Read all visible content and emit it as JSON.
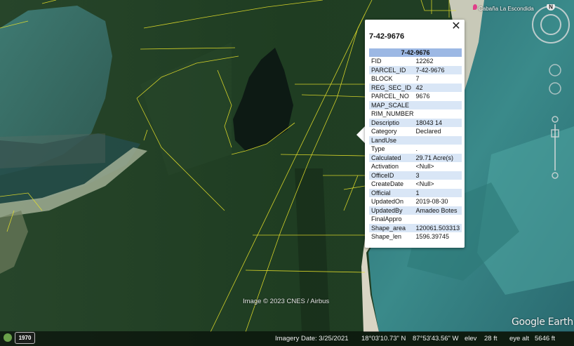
{
  "popup": {
    "title": "7-42-9676",
    "table_header": "7-42-9676",
    "close_label": "✕",
    "rows": [
      {
        "key": "FID",
        "value": "12262"
      },
      {
        "key": "PARCEL_ID",
        "value": "7-42-9676"
      },
      {
        "key": "BLOCK",
        "value": "7"
      },
      {
        "key": "REG_SEC_ID",
        "value": "42"
      },
      {
        "key": "PARCEL_NO",
        "value": "9676"
      },
      {
        "key": "MAP_SCALE",
        "value": ""
      },
      {
        "key": "RIM_NUMBER",
        "value": ""
      },
      {
        "key": "Descriptio",
        "value": "18043 14"
      },
      {
        "key": "Category",
        "value": "Declared"
      },
      {
        "key": "LandUse",
        "value": ""
      },
      {
        "key": "Type",
        "value": "."
      },
      {
        "key": "Calculated",
        "value": "29.71 Acre(s)"
      },
      {
        "key": "Activation",
        "value": "<Null>"
      },
      {
        "key": "OfficeID",
        "value": "3"
      },
      {
        "key": "CreateDate",
        "value": "<Null>"
      },
      {
        "key": "Official",
        "value": "1"
      },
      {
        "key": "UpdatedOn",
        "value": "2019-08-30"
      },
      {
        "key": "UpdatedBy",
        "value": "Amadeo Botes"
      },
      {
        "key": "FinalAppro",
        "value": ""
      },
      {
        "key": "Shape_area",
        "value": "120061.503313"
      },
      {
        "key": "Shape_len",
        "value": "1596.39745"
      }
    ]
  },
  "map": {
    "credit": "Image © 2023 CNES / Airbus",
    "brand": "Google Earth",
    "place_label": "Cabaña La Escondida",
    "compass_label": "N"
  },
  "status": {
    "year": "1970",
    "imagery_date": "Imagery Date: 3/25/2021",
    "latitude": "18°03'10.73\" N",
    "longitude": "87°53'43.56\" W",
    "elev_label": "elev",
    "elev_value": "28 ft",
    "eye_alt_label": "eye alt",
    "eye_alt_value": "5646 ft"
  },
  "colors": {
    "header_row": "#9cb8e4",
    "alt_row": "#d9e6f6",
    "parcel_lines": "#e8e22a"
  }
}
